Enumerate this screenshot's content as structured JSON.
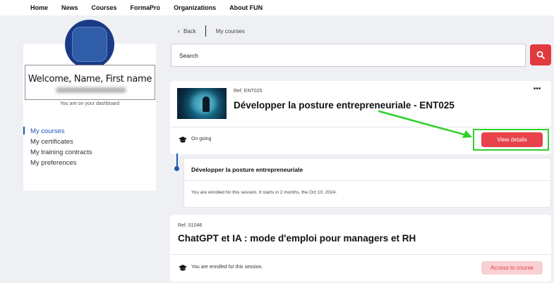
{
  "nav": {
    "items": [
      "Home",
      "News",
      "Courses",
      "FormaPro",
      "Organizations",
      "About FUN"
    ]
  },
  "sidebar": {
    "welcome": "Welcome, Name, First name",
    "dashboard_note": "You are on your dashboard",
    "menu": [
      {
        "label": "My courses",
        "active": true
      },
      {
        "label": "My certificates",
        "active": false
      },
      {
        "label": "My training contracts",
        "active": false
      },
      {
        "label": "My preferences",
        "active": false
      }
    ]
  },
  "breadcrumb": {
    "back": "Back",
    "current": "My courses"
  },
  "search": {
    "placeholder": "Search"
  },
  "courses": [
    {
      "ref": "Ref. ENT025",
      "title": "Développer la posture entrepreneuriale - ENT025",
      "status": "On going",
      "action": "View details",
      "session": {
        "title": "Développer la posture entrepreneuriale",
        "note": "You are enrolled for this session. It starts in 2 months, the Oct 10, 2024."
      }
    },
    {
      "ref": "Ref. 01046",
      "title": "ChatGPT et IA : mode d'emploi pour managers et RH",
      "status": "You are enrolled for this session.",
      "action": "Access to course"
    }
  ],
  "colors": {
    "accent": "#e8424b",
    "accent_light": "#f9d0d3",
    "link_active": "#1f57b3",
    "annotation": "#2ed12a",
    "background": "#eef0f4"
  }
}
